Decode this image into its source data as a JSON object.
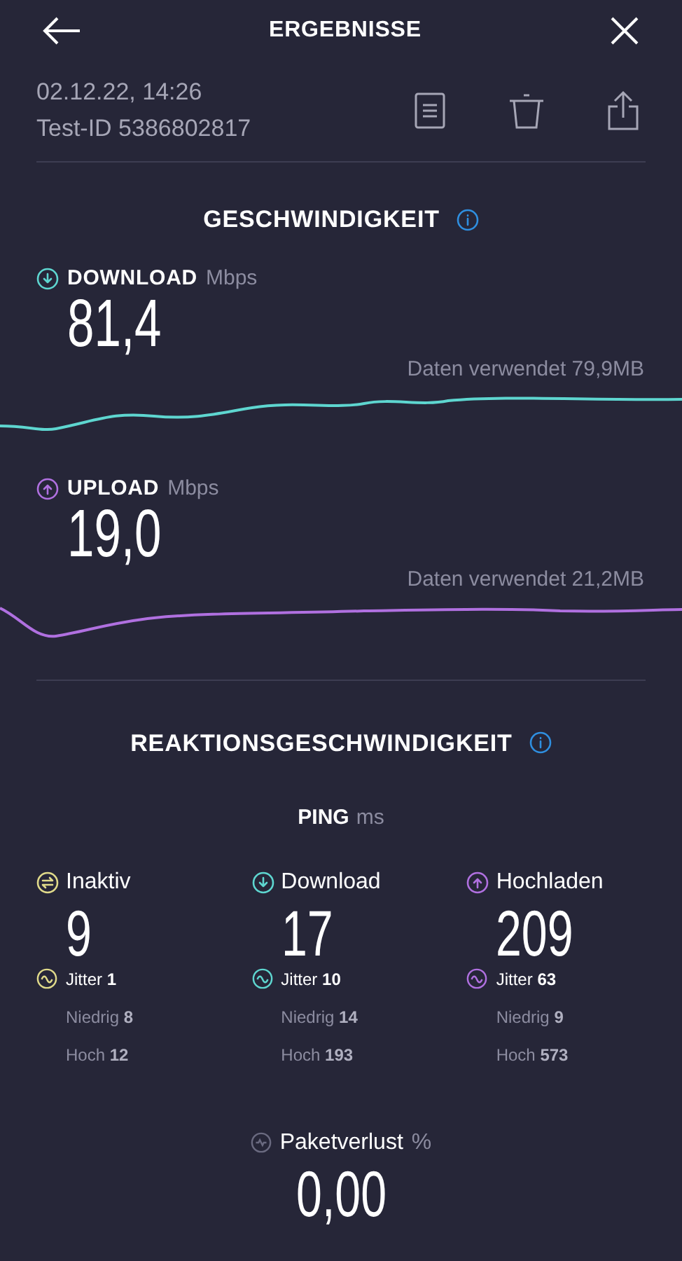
{
  "header": {
    "title": "ERGEBNISSE"
  },
  "meta": {
    "date": "02.12.22, 14:26",
    "test_id": "Test-ID 5386802817"
  },
  "speed": {
    "title": "GESCHWINDIGKEIT",
    "items": [
      {
        "kind": "down",
        "label": "DOWNLOAD",
        "unit": "Mbps",
        "value": "81,4",
        "data_used": "Daten verwendet 79,9MB",
        "color": "#5ed6d0"
      },
      {
        "kind": "up",
        "label": "UPLOAD",
        "unit": "Mbps",
        "value": "19,0",
        "data_used": "Daten verwendet 21,2MB",
        "color": "#b070e0"
      }
    ]
  },
  "latency": {
    "title": "REAKTIONSGESCHWINDIGKEIT",
    "ping_label": "PING",
    "ping_unit": "ms",
    "columns": [
      {
        "kind": "idle",
        "label": "Inaktiv",
        "value": "9",
        "jitter_label": "Jitter",
        "jitter": "1",
        "low_label": "Niedrig",
        "low": "8",
        "high_label": "Hoch",
        "high": "12",
        "color": "#e0da8a"
      },
      {
        "kind": "down",
        "label": "Download",
        "value": "17",
        "jitter_label": "Jitter",
        "jitter": "10",
        "low_label": "Niedrig",
        "low": "14",
        "high_label": "Hoch",
        "high": "193",
        "color": "#5ed6d0"
      },
      {
        "kind": "up",
        "label": "Hochladen",
        "value": "209",
        "jitter_label": "Jitter",
        "jitter": "63",
        "low_label": "Niedrig",
        "low": "9",
        "high_label": "Hoch",
        "high": "573",
        "color": "#b070e0"
      }
    ]
  },
  "packet_loss": {
    "label": "Paketverlust",
    "unit": "%",
    "value": "0,00"
  }
}
